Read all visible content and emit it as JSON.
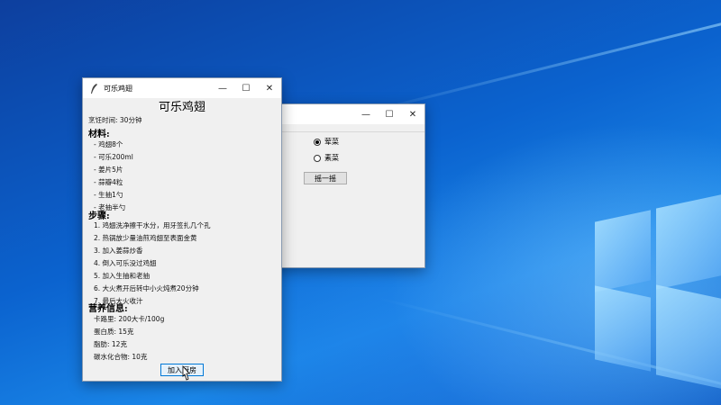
{
  "front_window": {
    "title": "可乐鸡翅",
    "recipe_title": "可乐鸡翅",
    "cook_time": "烹饪时间: 30分钟",
    "ingredients_heading": "材料:",
    "ingredients": [
      "- 鸡翅8个",
      "- 可乐200ml",
      "- 姜片5片",
      "- 蒜瓣4粒",
      "- 生抽1勺",
      "- 老抽半勺"
    ],
    "steps_heading": "步骤:",
    "steps": [
      "1. 鸡翅洗净擦干水分，用牙签扎几个孔",
      "2. 热锅放少量油煎鸡翅至表面金黄",
      "3. 加入姜蒜炒香",
      "4. 倒入可乐没过鸡翅",
      "5. 加入生抽和老抽",
      "6. 大火煮开后转中小火炖煮20分钟",
      "7. 最后大火收汁"
    ],
    "nutrition_heading": "营养信息:",
    "nutrition": [
      "卡路里: 200大卡/100g",
      "蛋白质: 15克",
      "脂肪: 12克",
      "碳水化合物: 10克"
    ],
    "add_button": "加入厨房"
  },
  "back_window": {
    "radio_options": [
      {
        "label": "荤菜",
        "selected": true
      },
      {
        "label": "素菜",
        "selected": false
      }
    ],
    "shake_button": "摇一摇"
  },
  "titlebar_icons": {
    "minimize": "—",
    "maximize": "☐",
    "close": "✕"
  }
}
